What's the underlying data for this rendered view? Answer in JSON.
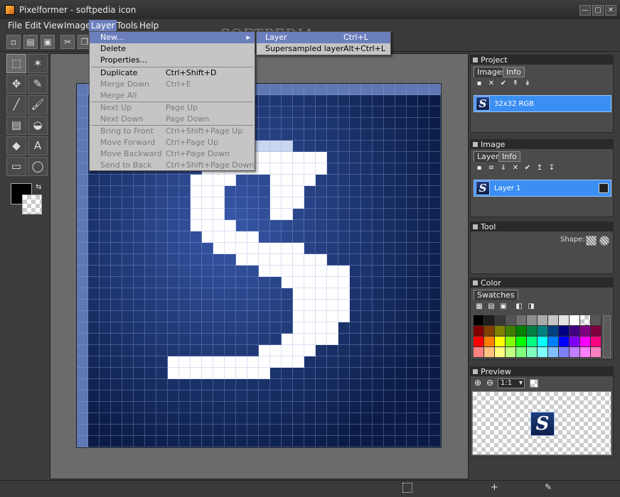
{
  "window": {
    "title": "Pixelformer - softpedia icon",
    "btn_min": "—",
    "btn_max": "□",
    "btn_close": "✕"
  },
  "watermark": "SOFTPEDIA",
  "menubar": [
    "File",
    "Edit",
    "View",
    "Image",
    "Layer",
    "Tools",
    "Help"
  ],
  "layer_menu": {
    "items": [
      {
        "label": "New...",
        "shortcut": "",
        "state": "highlight",
        "submenu": true
      },
      {
        "label": "Delete",
        "shortcut": "",
        "state": "enabled"
      },
      {
        "label": "Properties...",
        "shortcut": "",
        "state": "enabled"
      },
      {
        "label": "Duplicate",
        "shortcut": "Ctrl+Shift+D",
        "state": "enabled"
      },
      {
        "label": "Merge Down",
        "shortcut": "Ctrl+E",
        "state": "disabled"
      },
      {
        "label": "Merge All",
        "shortcut": "",
        "state": "disabled"
      },
      {
        "label": "Next Up",
        "shortcut": "Page Up",
        "state": "disabled"
      },
      {
        "label": "Next Down",
        "shortcut": "Page Down",
        "state": "disabled"
      },
      {
        "label": "Bring to Front",
        "shortcut": "Ctrl+Shift+Page Up",
        "state": "disabled"
      },
      {
        "label": "Move Forward",
        "shortcut": "Ctrl+Page Up",
        "state": "disabled"
      },
      {
        "label": "Move Backward",
        "shortcut": "Ctrl+Page Down",
        "state": "disabled"
      },
      {
        "label": "Send to Back",
        "shortcut": "Ctrl+Shift+Page Down",
        "state": "disabled"
      }
    ],
    "submenu_arrow": "▸"
  },
  "new_submenu": {
    "items": [
      {
        "label": "Layer",
        "shortcut": "Ctrl+L",
        "state": "highlight"
      },
      {
        "label": "Supersampled layer",
        "shortcut": "Alt+Ctrl+L",
        "state": "enabled"
      }
    ]
  },
  "toolbar": {
    "icons": [
      "new-icon",
      "open-icon",
      "save-icon",
      "cut-icon",
      "copy-icon"
    ],
    "glyphs": [
      "▫",
      "▤",
      "▣",
      "✂",
      "❐"
    ]
  },
  "tools": {
    "glyphs": [
      "⬚",
      "✶",
      "✥",
      "✎",
      "╱",
      "🖌",
      "▤",
      "◒",
      "◆",
      "A",
      "▭",
      "◯"
    ],
    "names": [
      "rect-select-icon",
      "magic-wand-icon",
      "move-icon",
      "eyedropper-icon",
      "line-icon",
      "brush-icon",
      "gradient-icon",
      "fill-icon",
      "eraser-icon",
      "text-icon",
      "rectangle-icon",
      "ellipse-icon"
    ],
    "primary_color": "#000000",
    "swap_glyph": "⇆"
  },
  "canvas": {
    "size": 32,
    "letter_rows": [
      "................................",
      "................................",
      "................................",
      "................................",
      "................................",
      "..............ooooo.............",
      ".............WWWWWWWWW..........",
      "...........WWWWWWWWWWW..........",
      "..........WWWW...WWWW...........",
      "..........WWW....WWW............",
      "..........WWW....WWW............",
      "..........WWW....WW.............",
      "..........WWWW..................",
      "...........WWWWW................",
      "............WWWWWWWW............",
      "..............WWWWWWWW..........",
      "................WWWWWWWW........",
      "..................WWWWWW........",
      "...................WWWWW........",
      "...................WWWWW........",
      "...................WWWWW........",
      "...................WWWW.........",
      "..................WWWWW.........",
      "................WWWWW...........",
      "........WWWWWWWWWWWW............",
      "........WWWWWWWWW...............",
      "................................",
      "................................",
      "................................",
      "................................",
      "................................",
      "................................"
    ]
  },
  "project_panel": {
    "header": "Project",
    "tabs": [
      "Images",
      "Info"
    ],
    "item_label": "32x32 RGB",
    "icons": [
      "new-image-icon",
      "delete-image-icon",
      "settings-icon",
      "up-icon",
      "down-icon"
    ],
    "glyphs": [
      "▪",
      "✕",
      "✔",
      "↟",
      "↡"
    ]
  },
  "image_panel": {
    "header": "Image",
    "tabs": [
      "Layers",
      "Info"
    ],
    "item_label": "Layer 1",
    "icons": [
      "new-layer-icon",
      "stack-icon",
      "merge-icon",
      "delete-layer-icon",
      "properties-icon",
      "move-up-icon",
      "move-down-icon"
    ],
    "glyphs": [
      "▪",
      "≡",
      "⇓",
      "✕",
      "✔",
      "↥",
      "↧"
    ]
  },
  "tool_panel": {
    "header": "Tool",
    "shape_label": "Shape:"
  },
  "color_panel": {
    "header": "Color",
    "tabs": [
      "Swatches"
    ],
    "icons": [
      "grid-icon",
      "open-swatch-icon",
      "save-swatch-icon",
      "swatch-a-icon",
      "swatch-b-icon"
    ],
    "glyphs": [
      "▦",
      "▤",
      "▣",
      "◧",
      "◨"
    ],
    "swatches": [
      "#000000",
      "#1c1c1c",
      "#383838",
      "#555555",
      "#717171",
      "#8d8d8d",
      "#aaaaaa",
      "#c6c6c6",
      "#e2e2e2",
      "#ffffff",
      "checker",
      "#555555",
      "#800000",
      "#804000",
      "#808000",
      "#408000",
      "#008000",
      "#008040",
      "#008080",
      "#004080",
      "#000080",
      "#400080",
      "#800080",
      "#800040",
      "#ff0000",
      "#ff8000",
      "#ffff00",
      "#80ff00",
      "#00ff00",
      "#00ff80",
      "#00ffff",
      "#0080ff",
      "#0000ff",
      "#8000ff",
      "#ff00ff",
      "#ff0080",
      "#ff8080",
      "#ffc080",
      "#ffff80",
      "#c0ff80",
      "#80ff80",
      "#80ffc0",
      "#80ffff",
      "#80c0ff",
      "#8080ff",
      "#c080ff",
      "#ff80ff",
      "#ff80c0"
    ]
  },
  "preview_panel": {
    "header": "Preview",
    "zoom_in": "⊕",
    "zoom_out": "⊖",
    "zoom": "1:1",
    "dropdown_glyph": "▾",
    "logo_letter": "S"
  },
  "logo_letter": "S"
}
